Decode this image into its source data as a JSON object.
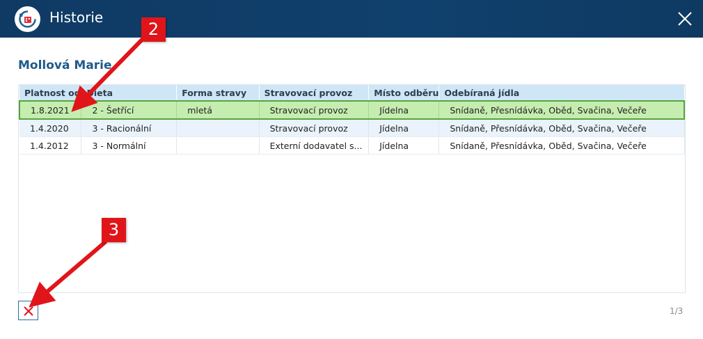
{
  "window": {
    "title": "Historie",
    "app_icon": "calendar-clock-icon",
    "close_icon": "close-icon"
  },
  "person": {
    "name": "Mollová Marie"
  },
  "table": {
    "columns": [
      "Platnost od",
      "Dieta",
      "Forma stravy",
      "Stravovací provoz",
      "Místo odběru",
      "Odebíraná jídla"
    ],
    "rows": [
      [
        "1.8.2021",
        "2 - Šetřící",
        "mletá",
        "Stravovací provoz",
        "Jídelna",
        "Snídaně, Přesnídávka, Oběd, Svačina, Večeře"
      ],
      [
        "1.4.2020",
        "3 - Racionální",
        "",
        "Stravovací provoz",
        "Jídelna",
        "Snídaně, Přesnídávka, Oběd, Svačina, Večeře"
      ],
      [
        "1.4.2012",
        "3 - Normální",
        "",
        "Externí dodavatel s...",
        "Jídelna",
        "Snídaně, Přesnídávka, Oběd, Svačina, Večeře"
      ]
    ],
    "selected_row": 0
  },
  "footer": {
    "delete_icon": "delete-x-icon",
    "pager": "1/3"
  },
  "annotations": [
    {
      "label": "2"
    },
    {
      "label": "3"
    }
  ],
  "colors": {
    "titlebar": "#10406d",
    "selected_row": "#c6edb0",
    "selected_border": "#56a43f",
    "header": "#cfe6f6",
    "accent_red": "#e0151a"
  }
}
